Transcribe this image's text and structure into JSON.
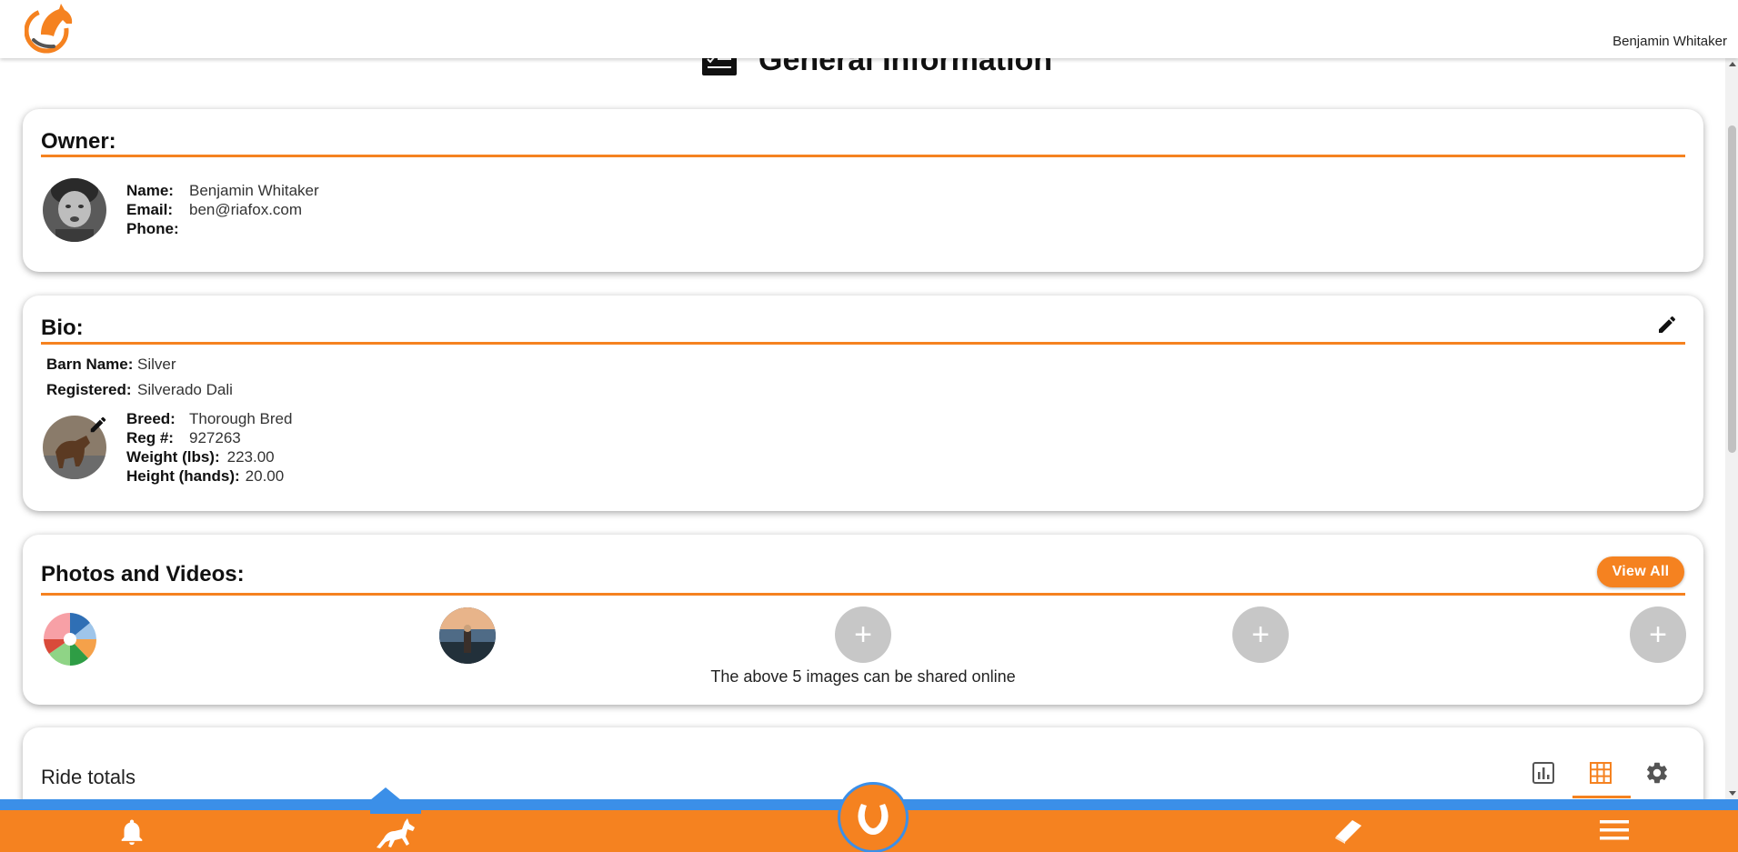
{
  "topbar": {
    "user_name": "Benjamin Whitaker"
  },
  "page_header": {
    "title": "General Information"
  },
  "owner": {
    "title": "Owner:",
    "name_label": "Name:",
    "name_value": "Benjamin Whitaker",
    "email_label": "Email:",
    "email_value": "ben@riafox.com",
    "phone_label": "Phone:",
    "phone_value": ""
  },
  "bio": {
    "title": "Bio:",
    "barn_name_label": "Barn Name:",
    "barn_name_value": "Silver",
    "registered_label": "Registered:",
    "registered_value": "Silverado Dali",
    "breed_label": "Breed:",
    "breed_value": "Thorough Bred",
    "reg_label": "Reg #:",
    "reg_value": "927263",
    "weight_label": "Weight (lbs):",
    "weight_value": "223.00",
    "height_label": "Height (hands):",
    "height_value": "20.00"
  },
  "photos": {
    "title": "Photos and Videos:",
    "view_all_label": "View All",
    "add_symbol": "+",
    "share_note": "The above 5 images can be shared online"
  },
  "ride_totals": {
    "title": "Ride totals",
    "icons": [
      "chart-icon",
      "grid-icon",
      "gear-icon"
    ],
    "active_icon": "grid-icon"
  },
  "bottom_nav": {
    "items": [
      "bell-icon",
      "horse-icon",
      "horseshoe-icon",
      "book-icon",
      "menu-icon"
    ],
    "active_item": "horse-icon"
  },
  "colors": {
    "accent": "#f58220",
    "nav_blue": "#3b8fe8",
    "placeholder_gray": "#c7c7c7"
  }
}
